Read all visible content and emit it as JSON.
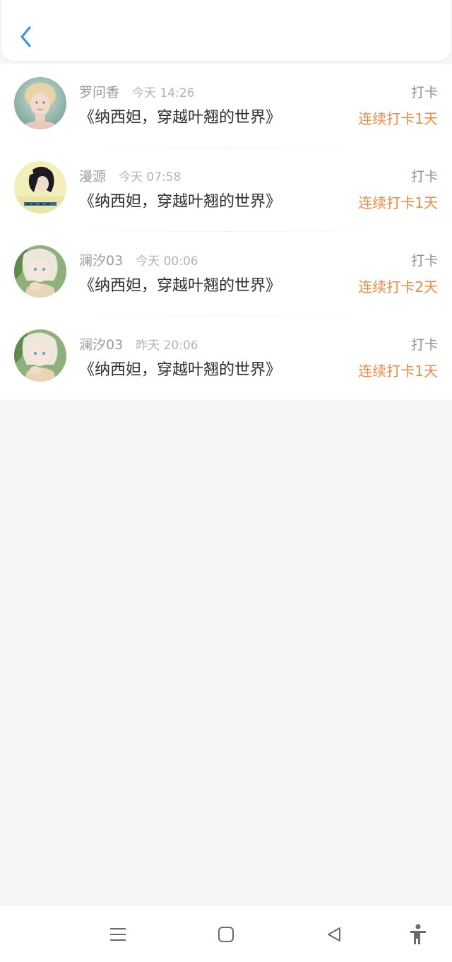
{
  "header": {
    "back_icon": "chevron-left-icon",
    "accent_color": "#2f93e6"
  },
  "records": [
    {
      "name": "罗问香",
      "time": "今天 14:26",
      "book": "《纳西妲，穿越叶翘的世界》",
      "action": "打卡",
      "streak": "连续打卡1天"
    },
    {
      "name": "漫源",
      "time": "今天 07:58",
      "book": "《纳西妲，穿越叶翘的世界》",
      "action": "打卡",
      "streak": "连续打卡1天"
    },
    {
      "name": "澜汐03",
      "time": "今天 00:06",
      "book": "《纳西妲，穿越叶翘的世界》",
      "action": "打卡",
      "streak": "连续打卡2天"
    },
    {
      "name": "澜汐03",
      "time": "昨天 20:06",
      "book": "《纳西妲，穿越叶翘的世界》",
      "action": "打卡",
      "streak": "连续打卡1天"
    }
  ],
  "colors": {
    "streak": "#ee8a44",
    "name": "#9a9a9a",
    "title": "#2d2d2d",
    "background": "#f7f5f5"
  },
  "nav": {
    "icons": [
      "menu-icon",
      "home-square-icon",
      "back-triangle-icon",
      "accessibility-icon"
    ]
  }
}
